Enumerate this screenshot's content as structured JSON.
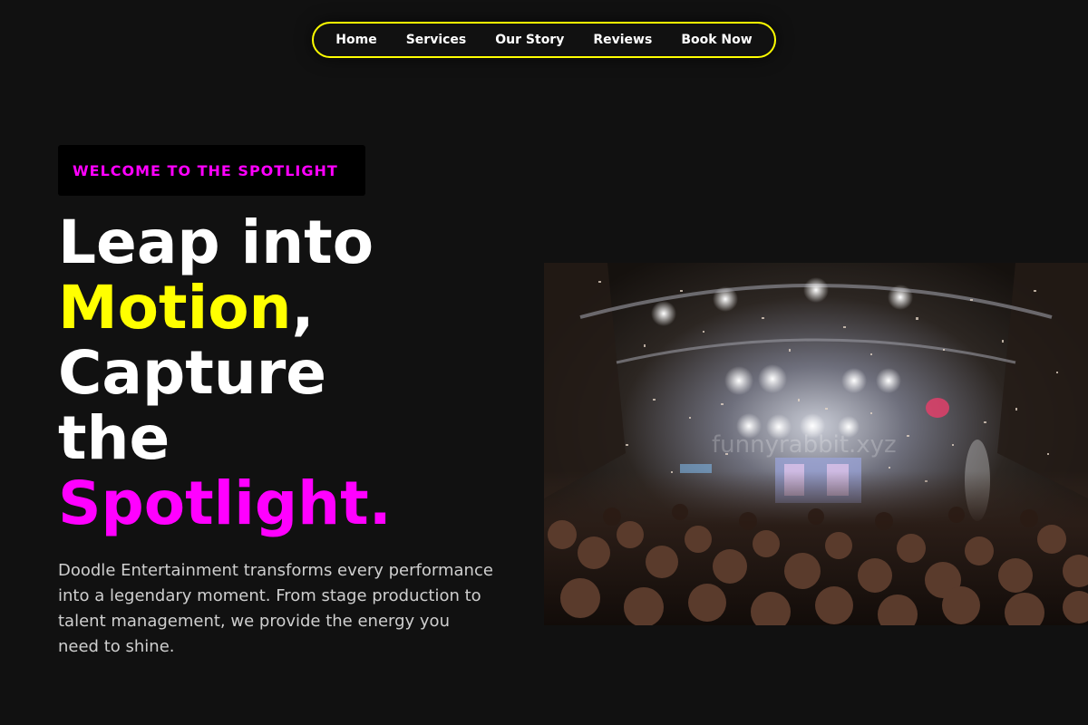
{
  "nav": {
    "items": [
      {
        "label": "Home"
      },
      {
        "label": "Services"
      },
      {
        "label": "Our Story"
      },
      {
        "label": "Reviews"
      },
      {
        "label": "Book Now"
      }
    ]
  },
  "hero": {
    "badge": "WELCOME TO THE SPOTLIGHT",
    "headline": {
      "line1": "Leap into",
      "line2_highlight": "Motion",
      "line2_rest": ",",
      "line3": "Capture",
      "line4": "the",
      "line5_highlight": "Spotlight."
    },
    "description": "Doodle Entertainment transforms every performance into a legendary moment. From stage production to talent management, we provide the energy you need to shine.",
    "image_watermark": "funnyrabbit.xyz"
  },
  "colors": {
    "background": "#111111",
    "accent_yellow": "#ffff00",
    "accent_magenta": "#ff00ff",
    "text_primary": "#ffffff",
    "text_secondary": "#cfcfcf"
  }
}
